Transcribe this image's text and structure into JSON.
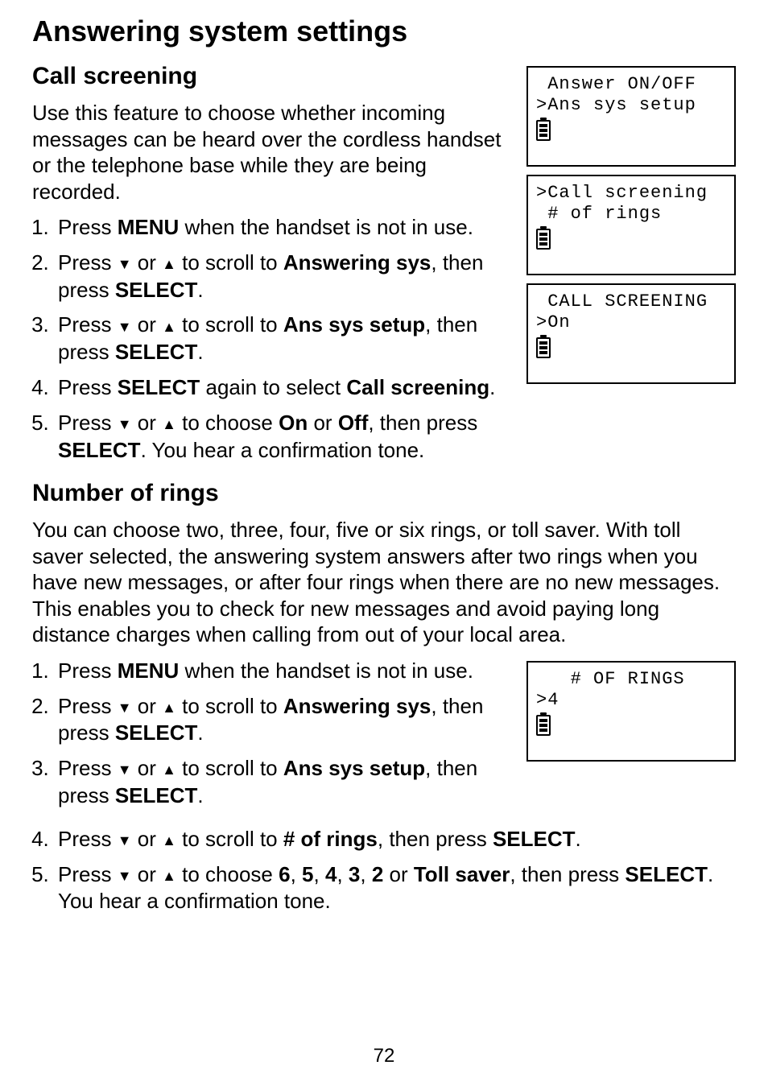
{
  "title": "Answering system settings",
  "section1": {
    "heading": "Call screening",
    "intro": "Use this feature to choose whether incoming messages can be heard over the cordless handset or the telephone base while they are being recorded.",
    "steps": {
      "s1_a": "Press ",
      "s1_b": "MENU",
      "s1_c": " when the handset is not in use.",
      "s2_a": "Press ",
      "s2_b": " or ",
      "s2_c": " to scroll to ",
      "s2_d": "Answering sys",
      "s2_e": ", then press ",
      "s2_f": "SELECT",
      "s2_g": ".",
      "s3_a": "Press ",
      "s3_b": " or ",
      "s3_c": " to scroll to ",
      "s3_d": "Ans sys setup",
      "s3_e": ", then press ",
      "s3_f": "SELECT",
      "s3_g": ".",
      "s4_a": "Press ",
      "s4_b": "SELECT",
      "s4_c": " again to select ",
      "s4_d": "Call screening",
      "s4_e": ".",
      "s5_a": "Press ",
      "s5_b": " or ",
      "s5_c": " to choose ",
      "s5_d": "On",
      "s5_e": " or ",
      "s5_f": "Off",
      "s5_g": ", then press ",
      "s5_h": "SELECT",
      "s5_i": ". You hear a confirmation tone."
    }
  },
  "section2": {
    "heading": "Number of rings",
    "intro": "You can choose two, three, four, five or six rings, or toll saver. With toll saver selected, the answering system answers after two rings when you have new messages, or after four rings when there are no new messages. This enables you to check for new messages and avoid paying long distance charges when calling from out of your local area.",
    "steps": {
      "s1_a": "Press ",
      "s1_b": "MENU",
      "s1_c": " when the handset is not in use.",
      "s2_a": "Press ",
      "s2_b": " or ",
      "s2_c": " to scroll to ",
      "s2_d": "Answering sys",
      "s2_e": ", then press ",
      "s2_f": "SELECT",
      "s2_g": ".",
      "s3_a": "Press ",
      "s3_b": " or ",
      "s3_c": " to scroll to ",
      "s3_d": "Ans sys setup",
      "s3_e": ", then press ",
      "s3_f": "SELECT",
      "s3_g": ".",
      "s4_a": "Press ",
      "s4_b": " or ",
      "s4_c": " to scroll to ",
      "s4_d": "# of rings",
      "s4_e": ", then press ",
      "s4_f": "SELECT",
      "s4_g": ".",
      "s5_a": "Press ",
      "s5_b": " or ",
      "s5_c": " to choose ",
      "s5_d": "6",
      "s5_e": ", ",
      "s5_f": "5",
      "s5_g": ", ",
      "s5_h": "4",
      "s5_i": ", ",
      "s5_j": "3",
      "s5_k": ", ",
      "s5_l": "2",
      "s5_m": " or ",
      "s5_n": "Toll saver",
      "s5_o": ", then press ",
      "s5_p": "SELECT",
      "s5_q": ". You hear a confirmation tone."
    }
  },
  "lcd1": {
    "line1": " Answer ON/OFF",
    "line2": ">Ans sys setup"
  },
  "lcd2": {
    "line1": ">Call screening",
    "line2": " # of rings"
  },
  "lcd3": {
    "line1": " CALL SCREENING",
    "line2": ">On"
  },
  "lcd4": {
    "line1": "   # OF RINGS",
    "line2": ">4"
  },
  "arrows": {
    "down": "▼",
    "up": "▲"
  },
  "page_number": "72"
}
